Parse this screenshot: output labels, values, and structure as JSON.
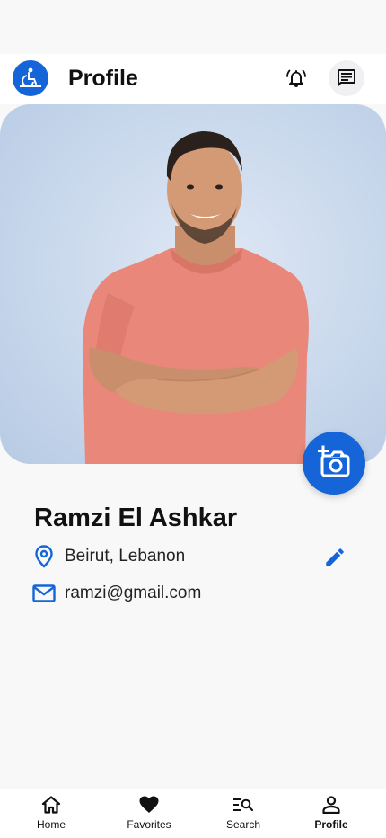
{
  "header": {
    "title": "Profile",
    "logo_icon": "wheelchair-accessibility-logo",
    "notification_icon": "bell-ring-icon",
    "chat_icon": "chat-message-icon"
  },
  "profile": {
    "name": "Ramzi El Ashkar",
    "location": "Beirut, Lebanon",
    "email": "ramzi@gmail.com",
    "photo_alt": "Profile photo",
    "camera_icon": "add-photo-camera-icon",
    "edit_icon": "pencil-edit-icon"
  },
  "bottom_nav": {
    "items": [
      {
        "label": "Home",
        "icon": "home-icon",
        "active": false
      },
      {
        "label": "Favorites",
        "icon": "heart-icon",
        "active": false
      },
      {
        "label": "Search",
        "icon": "search-list-icon",
        "active": false
      },
      {
        "label": "Profile",
        "icon": "person-icon",
        "active": true
      }
    ]
  },
  "colors": {
    "accent": "#1565d8",
    "background": "#f8f8f9",
    "header_bg": "#ffffff",
    "text": "#111111"
  }
}
